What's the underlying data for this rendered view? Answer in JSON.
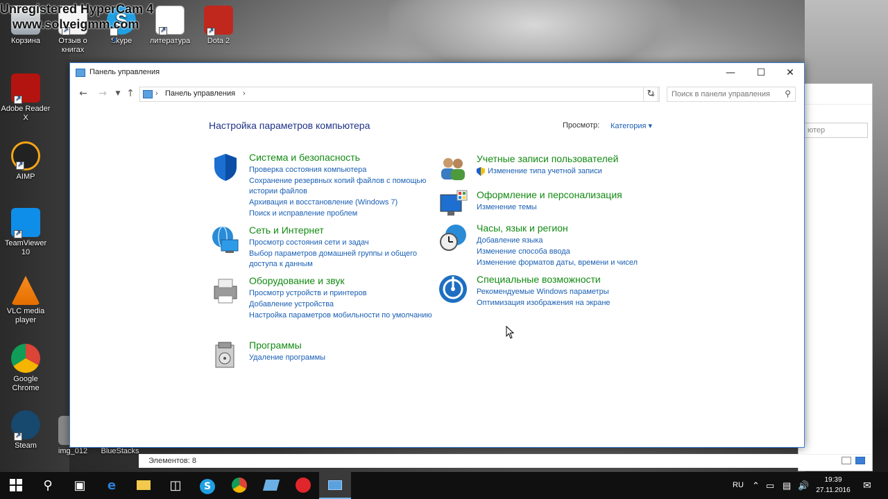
{
  "watermark": {
    "line1": "Unregistered HyperCam 4",
    "line2": "www.solveigmm.com"
  },
  "desktop_icons": [
    {
      "label": "Корзина"
    },
    {
      "label": "Отзыв о книгах"
    },
    {
      "label": "Skype"
    },
    {
      "label": "литература"
    },
    {
      "label": "Dota 2"
    },
    {
      "label": "Adobe Reader X"
    },
    {
      "label": "AIMP"
    },
    {
      "label": "TeamViewer 10"
    },
    {
      "label": "VLC media player"
    },
    {
      "label": "Google Chrome"
    },
    {
      "label": "Steam"
    },
    {
      "label": "img_012"
    },
    {
      "label": "BlueStacks"
    }
  ],
  "window": {
    "title": "Панель управления",
    "min_icon": "minimize-icon",
    "max_icon": "maximize-icon",
    "close_icon": "close-icon"
  },
  "address": {
    "crumb": "Панель управления",
    "search_placeholder": "Поиск в панели управления"
  },
  "content": {
    "heading": "Настройка параметров компьютера",
    "view_label": "Просмотр:",
    "view_value": "Категория ▾"
  },
  "categories": [
    {
      "title": "Система и безопасность",
      "links": [
        "Проверка состояния компьютера",
        "Сохранение резервных копий файлов с помощью истории файлов",
        "Архивация и восстановление (Windows 7)",
        "Поиск и исправление проблем"
      ]
    },
    {
      "title": "Сеть и Интернет",
      "links": [
        "Просмотр состояния сети и задач",
        "Выбор параметров домашней группы и общего доступа к данным"
      ]
    },
    {
      "title": "Оборудование и звук",
      "links": [
        "Просмотр устройств и принтеров",
        "Добавление устройства",
        "Настройка параметров мобильности по умолчанию"
      ]
    },
    {
      "title": "Программы",
      "links": [
        "Удаление программы"
      ]
    },
    {
      "title": "Учетные записи пользователей",
      "links": [
        "Изменение типа учетной записи"
      ]
    },
    {
      "title": "Оформление и персонализация",
      "links": [
        "Изменение темы"
      ]
    },
    {
      "title": "Часы, язык и регион",
      "links": [
        "Добавление языка",
        "Изменение способа ввода",
        "Изменение форматов даты, времени и чисел"
      ]
    },
    {
      "title": "Специальные возможности",
      "links": [
        "Рекомендуемые Windows параметры",
        "Оптимизация изображения на экране"
      ]
    }
  ],
  "status": {
    "text": "Элементов: 8"
  },
  "bg_window": {
    "search_fragment": "ютер"
  },
  "taskbar": {
    "lang": "RU",
    "time": "19:39",
    "date": "27.11.2016"
  }
}
